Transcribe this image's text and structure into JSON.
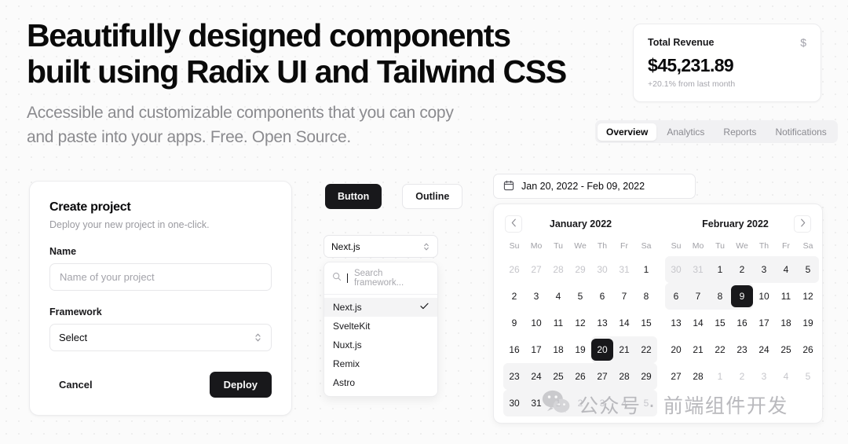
{
  "hero": {
    "heading_line1": "Beautifully designed components",
    "heading_line2": "built using Radix UI and Tailwind CSS",
    "subheading_line1": "Accessible and customizable components that you can copy",
    "subheading_line2": "and paste into your apps. Free. Open Source."
  },
  "revenue_card": {
    "title": "Total Revenue",
    "icon": "dollar-sign-icon",
    "icon_glyph": "$",
    "amount": "$45,231.89",
    "delta": "+20.1% from last month"
  },
  "tabs": {
    "items": [
      {
        "label": "Overview",
        "active": true
      },
      {
        "label": "Analytics",
        "active": false
      },
      {
        "label": "Reports",
        "active": false
      },
      {
        "label": "Notifications",
        "active": false
      }
    ]
  },
  "create_project_card": {
    "title": "Create project",
    "subtitle": "Deploy your new project in one-click.",
    "name_label": "Name",
    "name_placeholder": "Name of your project",
    "name_value": "",
    "framework_label": "Framework",
    "framework_value": "Select",
    "cancel_label": "Cancel",
    "deploy_label": "Deploy"
  },
  "button_row": {
    "primary_label": "Button",
    "outline_label": "Outline"
  },
  "combobox": {
    "trigger_value": "Next.js",
    "search_placeholder": "Search framework...",
    "search_value": "",
    "options": [
      {
        "label": "Next.js",
        "selected": true
      },
      {
        "label": "SvelteKit",
        "selected": false
      },
      {
        "label": "Nuxt.js",
        "selected": false
      },
      {
        "label": "Remix",
        "selected": false
      },
      {
        "label": "Astro",
        "selected": false
      }
    ]
  },
  "date_range_picker": {
    "display_value": "Jan 20, 2022 - Feb 09, 2022",
    "icon": "calendar-icon",
    "prev_label": "‹",
    "next_label": "›",
    "weekday_labels": [
      "Su",
      "Mo",
      "Tu",
      "We",
      "Th",
      "Fr",
      "Sa"
    ],
    "months": [
      {
        "title": "January 2022",
        "weeks": [
          [
            {
              "d": "26",
              "outside": true
            },
            {
              "d": "27",
              "outside": true
            },
            {
              "d": "28",
              "outside": true
            },
            {
              "d": "29",
              "outside": true
            },
            {
              "d": "30",
              "outside": true
            },
            {
              "d": "31",
              "outside": true
            },
            {
              "d": "1",
              "outside": false
            }
          ],
          [
            {
              "d": "2"
            },
            {
              "d": "3"
            },
            {
              "d": "4"
            },
            {
              "d": "5"
            },
            {
              "d": "6"
            },
            {
              "d": "7"
            },
            {
              "d": "8"
            }
          ],
          [
            {
              "d": "9"
            },
            {
              "d": "10"
            },
            {
              "d": "11"
            },
            {
              "d": "12"
            },
            {
              "d": "13"
            },
            {
              "d": "14"
            },
            {
              "d": "15"
            }
          ],
          [
            {
              "d": "16"
            },
            {
              "d": "17"
            },
            {
              "d": "18"
            },
            {
              "d": "19"
            },
            {
              "d": "20",
              "selected": true,
              "range": "start"
            },
            {
              "d": "21",
              "range": "mid"
            },
            {
              "d": "22",
              "range": "end"
            }
          ],
          [
            {
              "d": "23",
              "range": "start"
            },
            {
              "d": "24",
              "range": "mid"
            },
            {
              "d": "25",
              "range": "mid"
            },
            {
              "d": "26",
              "range": "mid"
            },
            {
              "d": "27",
              "range": "mid"
            },
            {
              "d": "28",
              "range": "mid"
            },
            {
              "d": "29",
              "range": "end"
            }
          ],
          [
            {
              "d": "30",
              "range": "start"
            },
            {
              "d": "31",
              "range": "mid"
            },
            {
              "d": "1",
              "outside": true,
              "range": "mid"
            },
            {
              "d": "2",
              "outside": true,
              "range": "mid"
            },
            {
              "d": "3",
              "outside": true,
              "range": "mid"
            },
            {
              "d": "4",
              "outside": true,
              "range": "mid"
            },
            {
              "d": "5",
              "outside": true,
              "range": "end"
            }
          ]
        ]
      },
      {
        "title": "February 2022",
        "weeks": [
          [
            {
              "d": "30",
              "outside": true,
              "range": "start"
            },
            {
              "d": "31",
              "outside": true,
              "range": "mid"
            },
            {
              "d": "1",
              "range": "mid"
            },
            {
              "d": "2",
              "range": "mid"
            },
            {
              "d": "3",
              "range": "mid"
            },
            {
              "d": "4",
              "range": "mid"
            },
            {
              "d": "5",
              "range": "end"
            }
          ],
          [
            {
              "d": "6",
              "range": "start"
            },
            {
              "d": "7",
              "range": "mid"
            },
            {
              "d": "8",
              "range": "mid"
            },
            {
              "d": "9",
              "selected": true,
              "range": "end"
            },
            {
              "d": "10"
            },
            {
              "d": "11"
            },
            {
              "d": "12"
            }
          ],
          [
            {
              "d": "13"
            },
            {
              "d": "14"
            },
            {
              "d": "15"
            },
            {
              "d": "16"
            },
            {
              "d": "17"
            },
            {
              "d": "18"
            },
            {
              "d": "19"
            }
          ],
          [
            {
              "d": "20"
            },
            {
              "d": "21"
            },
            {
              "d": "22"
            },
            {
              "d": "23"
            },
            {
              "d": "24"
            },
            {
              "d": "25"
            },
            {
              "d": "26"
            }
          ],
          [
            {
              "d": "27"
            },
            {
              "d": "28"
            },
            {
              "d": "1",
              "outside": true
            },
            {
              "d": "2",
              "outside": true
            },
            {
              "d": "3",
              "outside": true
            },
            {
              "d": "4",
              "outside": true
            },
            {
              "d": "5",
              "outside": true
            }
          ]
        ]
      }
    ]
  },
  "watermark": {
    "text": "公众号 · 前端组件开发",
    "icon": "wechat-logo-icon"
  },
  "colors": {
    "foreground": "#09090b",
    "muted": "#8b8b8f",
    "accent_dark": "#18181b",
    "surface": "#ffffff",
    "range_highlight": "#f4f4f5"
  }
}
